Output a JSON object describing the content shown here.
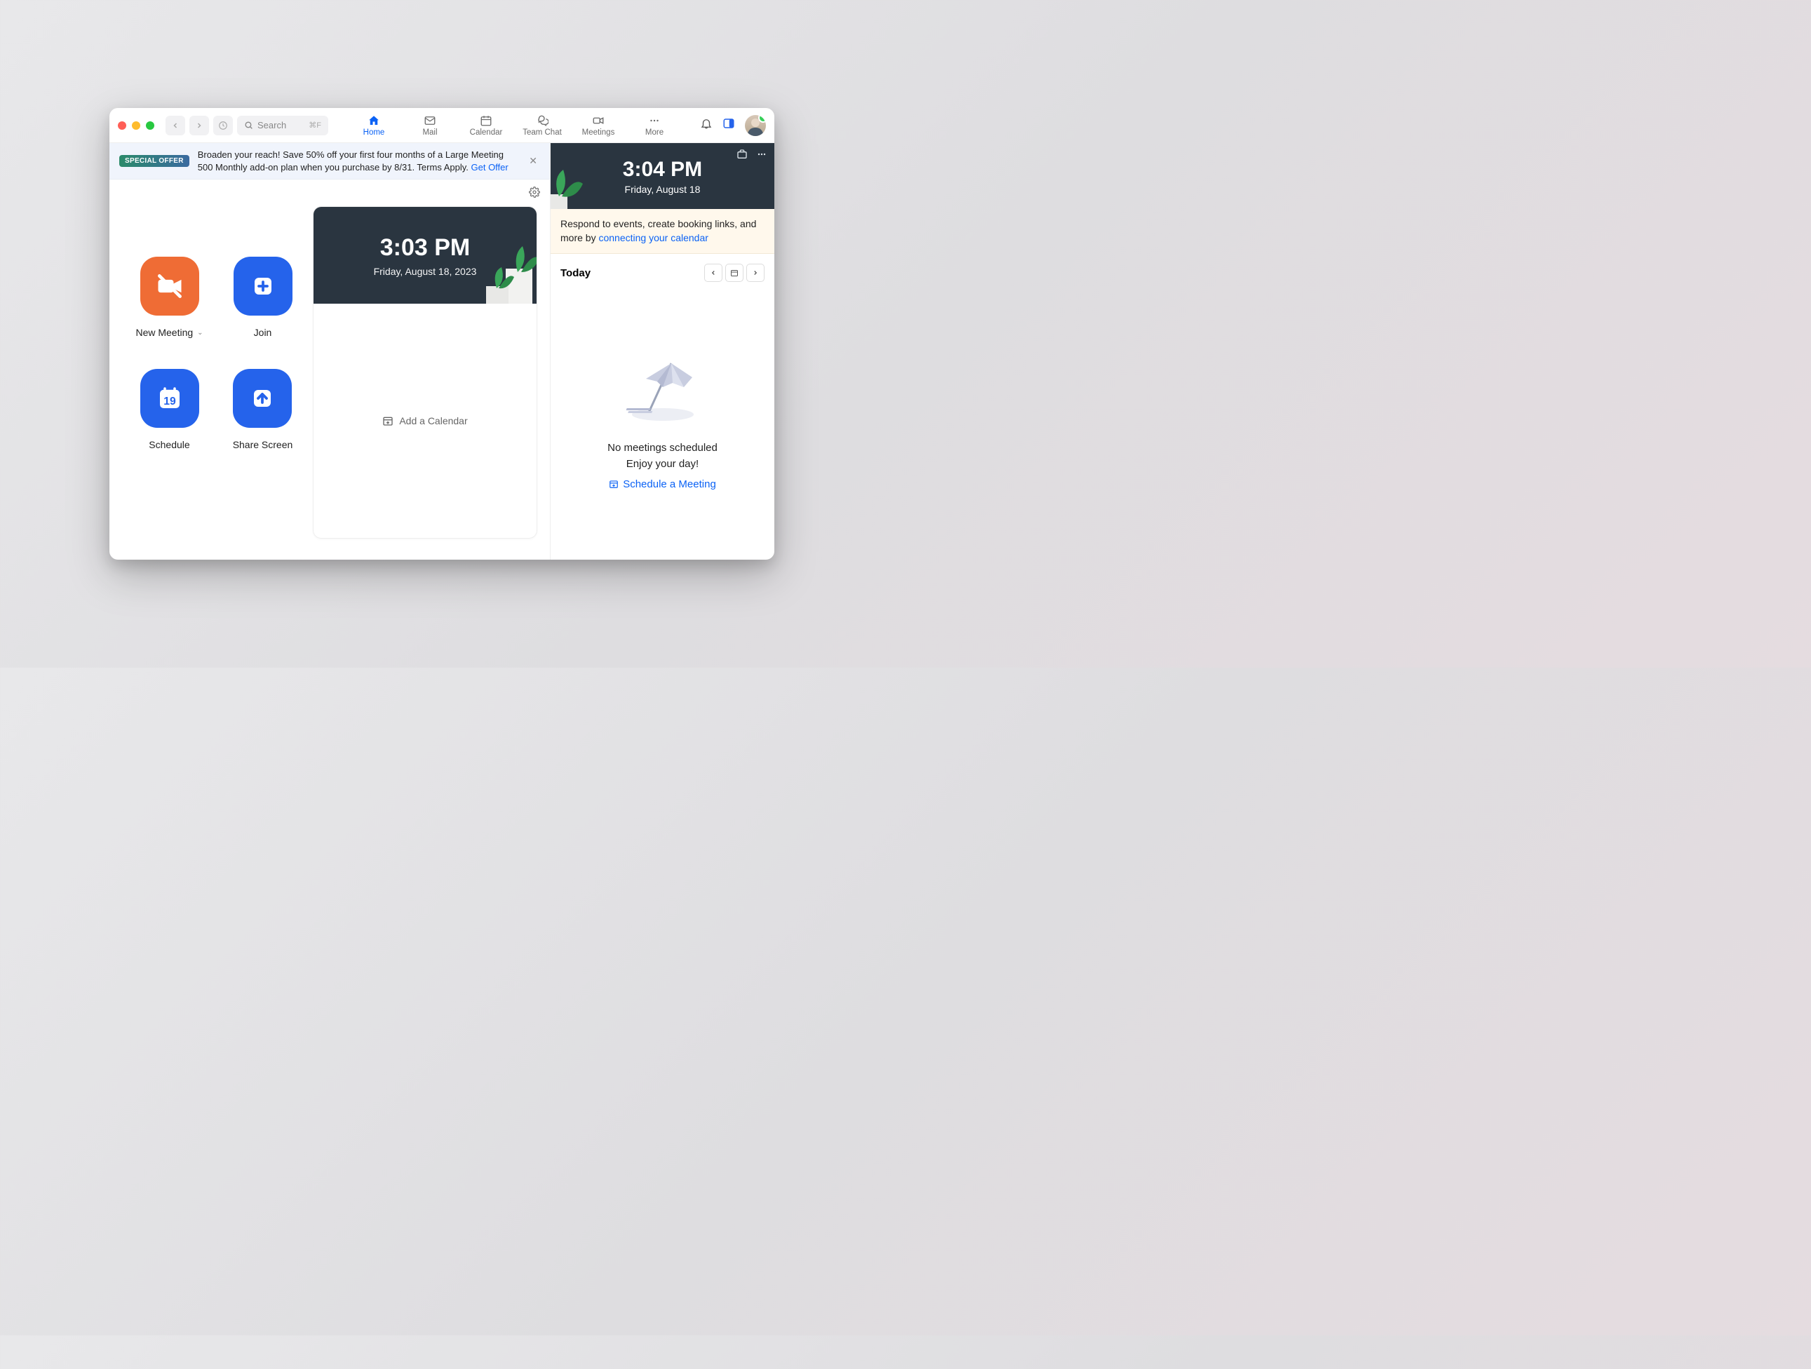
{
  "search": {
    "placeholder": "Search",
    "shortcut": "⌘F"
  },
  "tabs": {
    "home": "Home",
    "mail": "Mail",
    "calendar": "Calendar",
    "team_chat": "Team Chat",
    "meetings": "Meetings",
    "more": "More"
  },
  "banner": {
    "badge": "SPECIAL OFFER",
    "text": "Broaden your reach! Save 50% off your first four months of a Large Meeting 500 Monthly add-on plan when you purchase by 8/31. Terms Apply. ",
    "link": "Get Offer"
  },
  "tiles": {
    "new_meeting": "New Meeting",
    "join": "Join",
    "schedule": "Schedule",
    "schedule_day": "19",
    "share_screen": "Share Screen"
  },
  "clock_card": {
    "time": "3:03 PM",
    "date": "Friday, August 18, 2023",
    "add_calendar": "Add a Calendar"
  },
  "sidebar": {
    "time": "3:04 PM",
    "date": "Friday, August 18",
    "connect_text": "Respond to events, create booking links, and more by ",
    "connect_link": "connecting your calendar",
    "today": "Today",
    "empty1": "No meetings scheduled",
    "empty2": "Enjoy your day!",
    "schedule_link": "Schedule a Meeting"
  }
}
